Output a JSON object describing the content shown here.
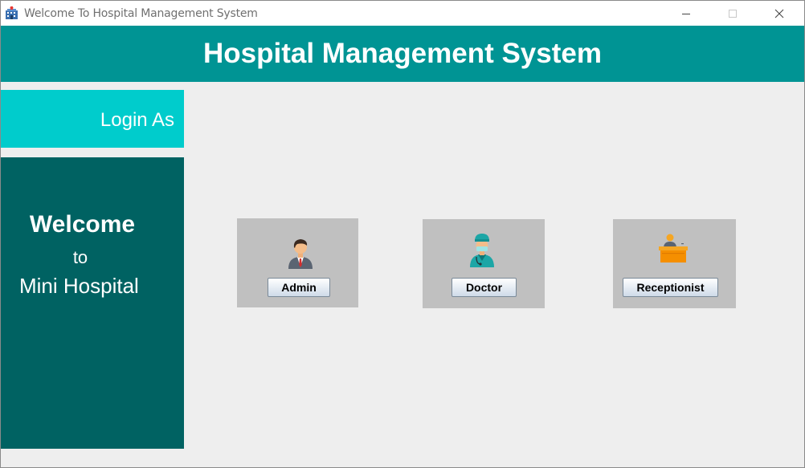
{
  "window": {
    "title": "Welcome To Hospital Management System",
    "icon": "hospital-building-icon"
  },
  "header": {
    "title": "Hospital Management System",
    "background": "#009494"
  },
  "sidebar": {
    "login_label": "Login As",
    "welcome_line1": "Welcome",
    "welcome_line2": "to",
    "welcome_line3": "Mini Hospital",
    "login_background": "#00cccc",
    "welcome_background": "#006262"
  },
  "roles": [
    {
      "label": "Admin",
      "icon": "admin-person-icon"
    },
    {
      "label": "Doctor",
      "icon": "doctor-icon"
    },
    {
      "label": "Receptionist",
      "icon": "receptionist-desk-icon"
    }
  ]
}
